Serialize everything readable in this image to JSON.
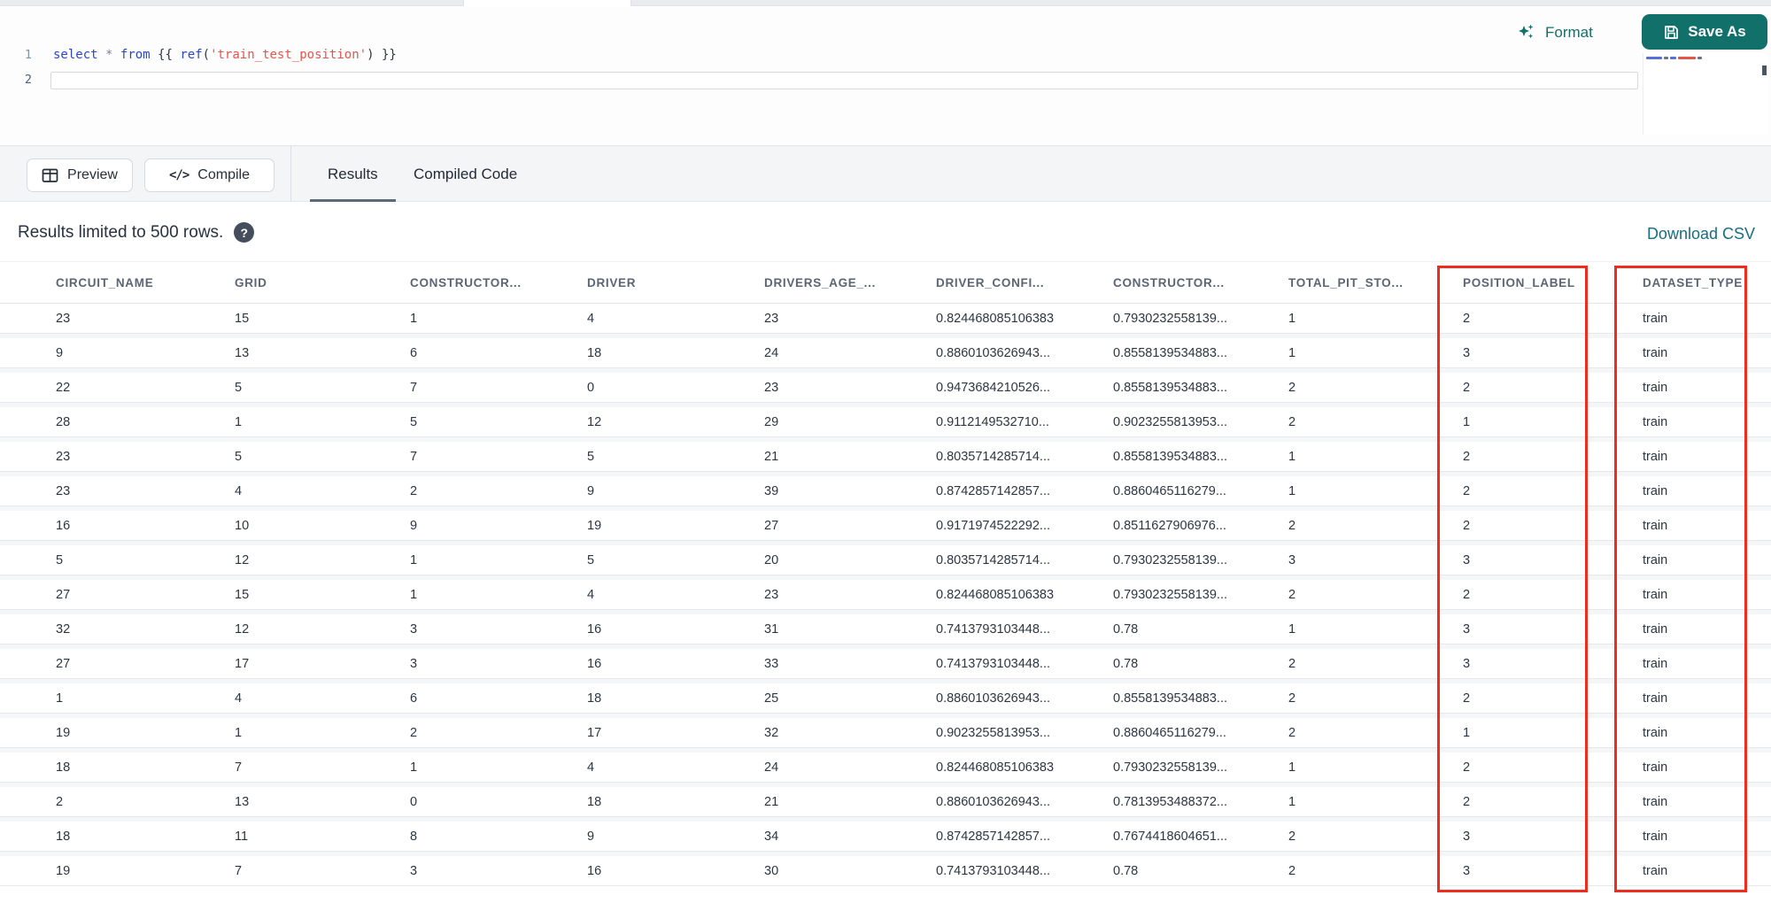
{
  "colors": {
    "accent_teal": "#11706a",
    "link_teal": "#176d82",
    "highlight_red": "#ee2d1e",
    "keyword_blue": "#2b46c8",
    "string_red": "#e4544b"
  },
  "editor": {
    "line_numbers": [
      "1",
      "2"
    ],
    "code_text": "select * from {{ ref('train_test_position') }}",
    "code_tokens": [
      {
        "t": "select",
        "c": "kw"
      },
      {
        "t": " ",
        "c": "pl"
      },
      {
        "t": "*",
        "c": "op"
      },
      {
        "t": " ",
        "c": "pl"
      },
      {
        "t": "from",
        "c": "kw"
      },
      {
        "t": " {{ ",
        "c": "pl"
      },
      {
        "t": "ref",
        "c": "kw"
      },
      {
        "t": "(",
        "c": "pl"
      },
      {
        "t": "'train_test_position'",
        "c": "str"
      },
      {
        "t": ") ",
        "c": "pl"
      },
      {
        "t": "}}",
        "c": "pl"
      }
    ],
    "format_label": "Format",
    "save_as_label": "Save As"
  },
  "toolbar": {
    "preview_label": "Preview",
    "compile_label": "Compile",
    "compile_glyph": "</>",
    "tabs": [
      {
        "label": "Results",
        "active": true
      },
      {
        "label": "Compiled Code",
        "active": false
      }
    ]
  },
  "results": {
    "info_text": "Results limited to 500 rows.",
    "help_glyph": "?",
    "download_label": "Download CSV"
  },
  "table": {
    "columns": [
      "CIRCUIT_NAME",
      "GRID",
      "CONSTRUCTOR...",
      "DRIVER",
      "DRIVERS_AGE_...",
      "DRIVER_CONFI...",
      "CONSTRUCTOR...",
      "TOTAL_PIT_STO...",
      "POSITION_LABEL",
      "DATASET_TYPE"
    ],
    "highlighted_columns": [
      "POSITION_LABEL",
      "DATASET_TYPE"
    ],
    "rows": [
      [
        "23",
        "15",
        "1",
        "4",
        "23",
        "0.824468085106383",
        "0.7930232558139...",
        "1",
        "2",
        "train"
      ],
      [
        "9",
        "13",
        "6",
        "18",
        "24",
        "0.8860103626943...",
        "0.8558139534883...",
        "1",
        "3",
        "train"
      ],
      [
        "22",
        "5",
        "7",
        "0",
        "23",
        "0.9473684210526...",
        "0.8558139534883...",
        "2",
        "2",
        "train"
      ],
      [
        "28",
        "1",
        "5",
        "12",
        "29",
        "0.9112149532710...",
        "0.9023255813953...",
        "2",
        "1",
        "train"
      ],
      [
        "23",
        "5",
        "7",
        "5",
        "21",
        "0.8035714285714...",
        "0.8558139534883...",
        "1",
        "2",
        "train"
      ],
      [
        "23",
        "4",
        "2",
        "9",
        "39",
        "0.8742857142857...",
        "0.8860465116279...",
        "1",
        "2",
        "train"
      ],
      [
        "16",
        "10",
        "9",
        "19",
        "27",
        "0.9171974522292...",
        "0.8511627906976...",
        "2",
        "2",
        "train"
      ],
      [
        "5",
        "12",
        "1",
        "5",
        "20",
        "0.8035714285714...",
        "0.7930232558139...",
        "3",
        "3",
        "train"
      ],
      [
        "27",
        "15",
        "1",
        "4",
        "23",
        "0.824468085106383",
        "0.7930232558139...",
        "2",
        "2",
        "train"
      ],
      [
        "32",
        "12",
        "3",
        "16",
        "31",
        "0.7413793103448...",
        "0.78",
        "1",
        "3",
        "train"
      ],
      [
        "27",
        "17",
        "3",
        "16",
        "33",
        "0.7413793103448...",
        "0.78",
        "2",
        "3",
        "train"
      ],
      [
        "1",
        "4",
        "6",
        "18",
        "25",
        "0.8860103626943...",
        "0.8558139534883...",
        "2",
        "2",
        "train"
      ],
      [
        "19",
        "1",
        "2",
        "17",
        "32",
        "0.9023255813953...",
        "0.8860465116279...",
        "2",
        "1",
        "train"
      ],
      [
        "18",
        "7",
        "1",
        "4",
        "24",
        "0.824468085106383",
        "0.7930232558139...",
        "1",
        "2",
        "train"
      ],
      [
        "2",
        "13",
        "0",
        "18",
        "21",
        "0.8860103626943...",
        "0.7813953488372...",
        "1",
        "2",
        "train"
      ],
      [
        "18",
        "11",
        "8",
        "9",
        "34",
        "0.8742857142857...",
        "0.7674418604651...",
        "2",
        "3",
        "train"
      ],
      [
        "19",
        "7",
        "3",
        "16",
        "30",
        "0.7413793103448...",
        "0.78",
        "2",
        "3",
        "train"
      ]
    ]
  }
}
